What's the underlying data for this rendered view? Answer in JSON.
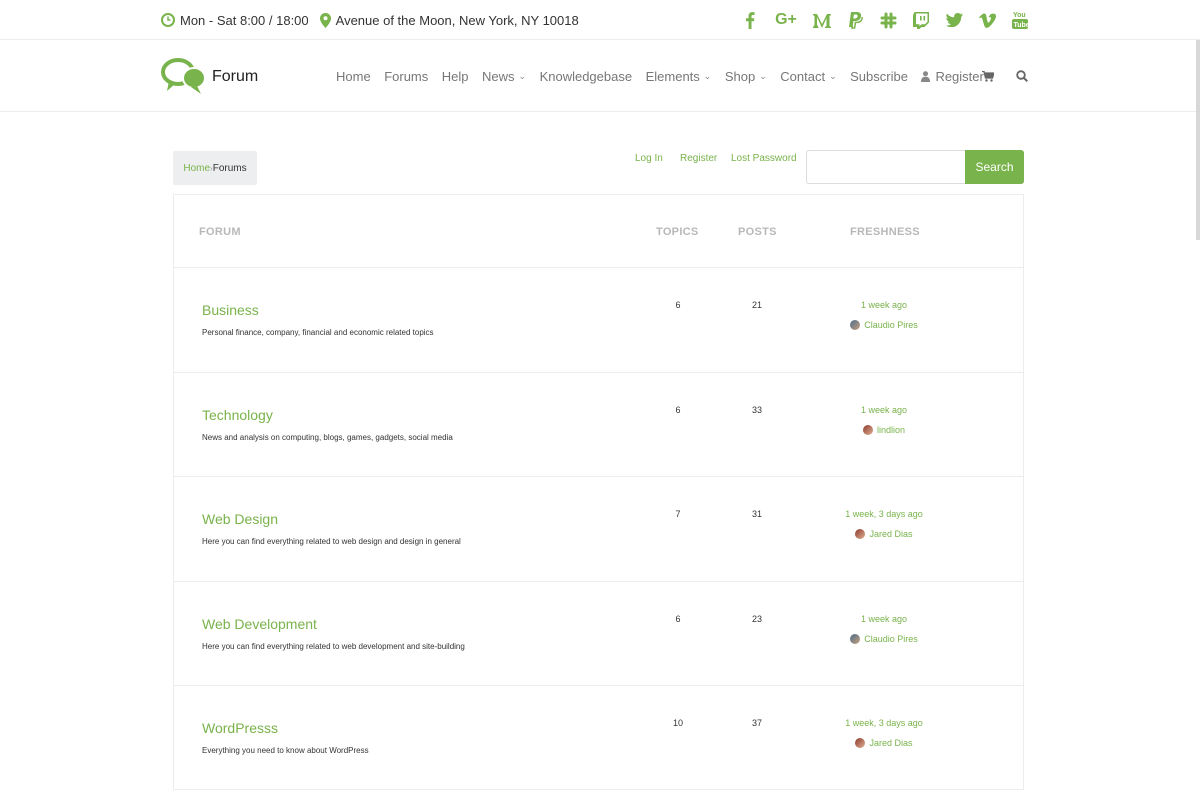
{
  "topbar": {
    "hours": "Mon - Sat 8:00 / 18:00",
    "address": "Avenue of the Moon, New York, NY 10018",
    "social": [
      "facebook-icon",
      "google-plus-icon",
      "medium-icon",
      "paypal-icon",
      "slack-icon",
      "twitch-icon",
      "twitter-icon",
      "vimeo-icon",
      "youtube-icon"
    ]
  },
  "header": {
    "logo_text": "Forum",
    "nav": [
      {
        "label": "Home",
        "has_caret": false
      },
      {
        "label": "Forums",
        "has_caret": false
      },
      {
        "label": "Help",
        "has_caret": false
      },
      {
        "label": "News",
        "has_caret": true
      },
      {
        "label": "Knowledgebase",
        "has_caret": false
      },
      {
        "label": "Elements",
        "has_caret": true
      },
      {
        "label": "Shop",
        "has_caret": true
      },
      {
        "label": "Contact",
        "has_caret": true
      },
      {
        "label": "Subscribe",
        "has_caret": false
      }
    ],
    "register_label": "Register"
  },
  "breadcrumb": {
    "home": "Home",
    "separator": "›",
    "current": "Forums"
  },
  "account": {
    "login": "Log In",
    "register": "Register",
    "lost_password": "Lost Password"
  },
  "search": {
    "button": "Search",
    "placeholder": ""
  },
  "table": {
    "headers": {
      "forum": "FORUM",
      "topics": "TOPICS",
      "posts": "POSTS",
      "freshness": "FRESHNESS"
    },
    "rows": [
      {
        "title": "Business",
        "desc": "Personal finance, company, financial and economic related topics",
        "topics": "6",
        "posts": "21",
        "freshness": "1 week ago",
        "author": "Claudio Pires"
      },
      {
        "title": "Technology",
        "desc": "News and analysis on computing, blogs, games, gadgets, social media",
        "topics": "6",
        "posts": "33",
        "freshness": "1 week ago",
        "author": "lindlion"
      },
      {
        "title": "Web Design",
        "desc": "Here you can find everything related to web design and design in general",
        "topics": "7",
        "posts": "31",
        "freshness": "1 week, 3 days ago",
        "author": "Jared Dias"
      },
      {
        "title": "Web Development",
        "desc": "Here you can find everything related to web development and site-building",
        "topics": "6",
        "posts": "23",
        "freshness": "1 week ago",
        "author": "Claudio Pires"
      },
      {
        "title": "WordPresss",
        "desc": "Everything you need to know about WordPress",
        "topics": "10",
        "posts": "37",
        "freshness": "1 week, 3 days ago",
        "author": "Jared Dias"
      }
    ]
  },
  "colors": {
    "accent": "#79b34b",
    "muted_header": "#b8b8b8"
  }
}
